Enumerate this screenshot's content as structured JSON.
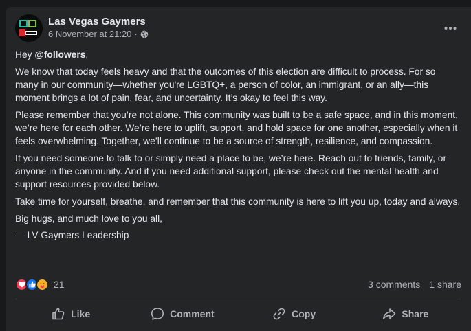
{
  "post": {
    "author": "Las Vegas Gaymers",
    "date": "6 November at 21:20",
    "separator": "·",
    "privacy_icon": "globe-icon",
    "greeting_prefix": "Hey ",
    "mention": "@followers",
    "greeting_suffix": ",",
    "paragraphs": [
      "We know that today feels heavy and that the outcomes of this election are difficult to process. For so many in our community—whether you're LGBTQ+, a person of color, an immigrant, or an ally—this moment brings a lot of pain, fear, and uncertainty. It’s okay to feel this way.",
      "Please remember that you’re not alone. This community was built to be a safe space, and in this moment, we’re here for each other. We’re here to uplift, support, and hold space for one another, especially when it feels overwhelming. Together, we’ll continue to be a source of strength, resilience, and compassion.",
      "If you need someone to talk to or simply need a place to be, we’re here. Reach out to friends, family, or anyone in the community. And if you need additional support, please check out the mental health and support resources provided below.",
      "Take time for yourself, breathe, and remember that this community is here to lift you up, today and always.",
      "Big hugs, and much love to you all,",
      "— LV Gaymers Leadership"
    ]
  },
  "reactions": {
    "icons": [
      "love-icon",
      "like-icon",
      "care-icon"
    ],
    "count": "21",
    "comments": "3 comments",
    "shares": "1 share"
  },
  "actions": {
    "like": "Like",
    "comment": "Comment",
    "copy": "Copy",
    "share": "Share"
  },
  "colors": {
    "background": "#18191a",
    "card": "#242526",
    "text_primary": "#e4e6eb",
    "text_secondary": "#b0b3b8",
    "love": "#f33e58",
    "like": "#1877f2",
    "care": "#f7b125"
  }
}
